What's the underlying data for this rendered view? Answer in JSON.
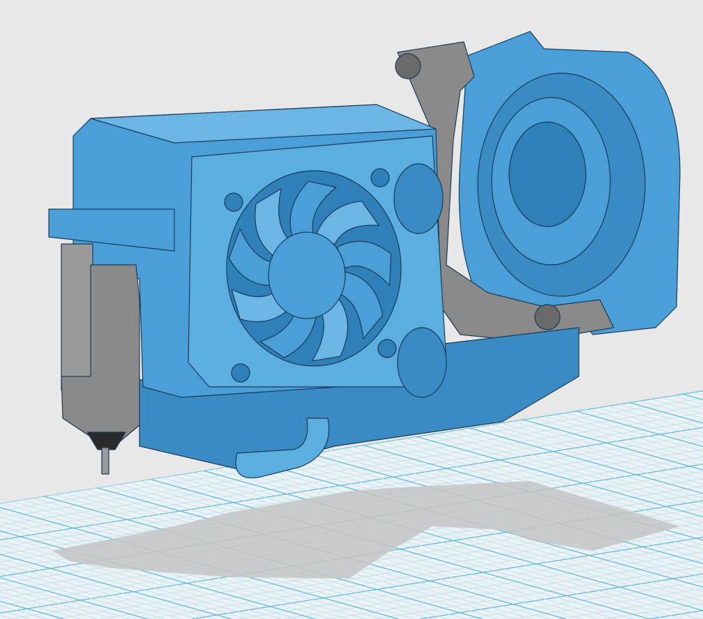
{
  "viewport": {
    "background_color": "#e8e8e8",
    "grid_plane_color": "#eaf2f5",
    "grid_minor_color": "#b9dbe8",
    "grid_major_color": "#5bb8d8",
    "shadow_color": "#c4c4c4"
  },
  "model": {
    "body_color": "#4a9fd8",
    "body_dark_color": "#2f7fb8",
    "body_light_color": "#6cb6e6",
    "edge_color": "#1a3a55",
    "hardware_color": "#8a8a8a",
    "hardware_dark_color": "#5a5a5a"
  }
}
